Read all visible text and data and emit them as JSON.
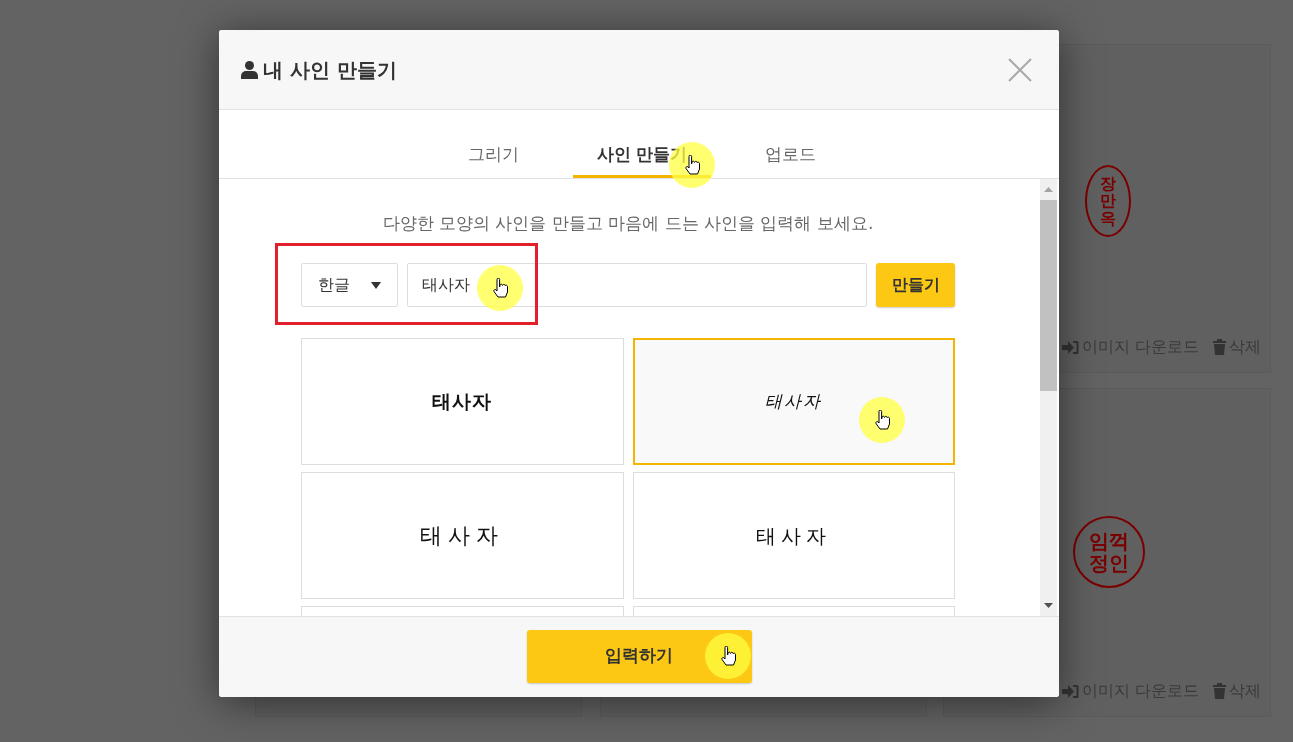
{
  "background_cards": [
    {
      "stamp": {
        "text": "장만옥",
        "kind": "oval"
      },
      "actions": [
        "이미지 다운로드",
        "삭제"
      ]
    },
    {
      "stamp": {
        "text": "임꺽정인",
        "kind": "round"
      },
      "actions": [
        "이미지 다운로드",
        "삭제"
      ]
    }
  ],
  "dialog": {
    "title": "내 사인 만들기",
    "tabs": [
      {
        "label": "그리기",
        "selected": false
      },
      {
        "label": "사인 만들기",
        "selected": true
      },
      {
        "label": "업로드",
        "selected": false
      }
    ],
    "description": "다양한 모양의 사인을 만들고 마음에 드는 사인을 입력해 보세요.",
    "language_select": {
      "value": "한글"
    },
    "name_input": {
      "value": "태사자"
    },
    "make_button": "만들기",
    "signatures": [
      {
        "text": "태사자",
        "selected": false
      },
      {
        "text": "태사자",
        "selected": true
      },
      {
        "text": "태사자",
        "selected": false
      },
      {
        "text": "태사자",
        "selected": false
      }
    ],
    "submit_button": "입력하기"
  }
}
